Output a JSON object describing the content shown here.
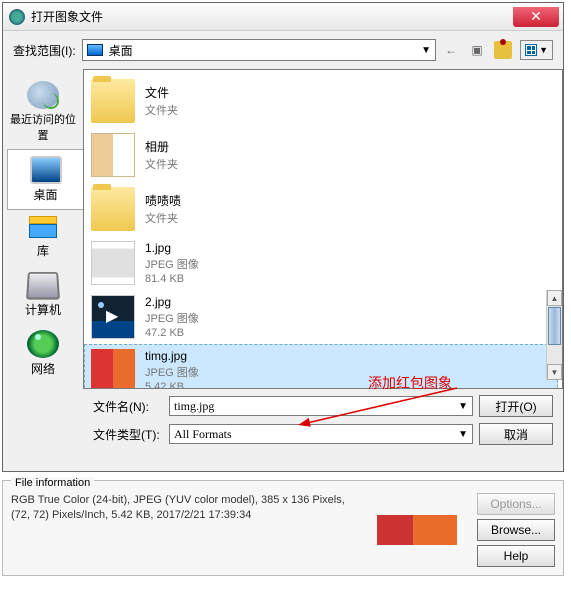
{
  "window": {
    "title": "打开图象文件"
  },
  "toolbar": {
    "lookin_label": "查找范围(I):",
    "location": "桌面"
  },
  "sidebar": {
    "items": [
      {
        "label": "最近访问的位置"
      },
      {
        "label": "桌面"
      },
      {
        "label": "库"
      },
      {
        "label": "计算机"
      },
      {
        "label": "网络"
      }
    ]
  },
  "files": [
    {
      "name": "文件",
      "type": "文件夹",
      "size": ""
    },
    {
      "name": "相册",
      "type": "文件夹",
      "size": ""
    },
    {
      "name": "啧啧啧",
      "type": "文件夹",
      "size": ""
    },
    {
      "name": "1.jpg",
      "type": "JPEG 图像",
      "size": "81.4 KB"
    },
    {
      "name": "2.jpg",
      "type": "JPEG 图像",
      "size": "47.2 KB"
    },
    {
      "name": "timg.jpg",
      "type": "JPEG 图像",
      "size": "5.42 KB"
    }
  ],
  "fields": {
    "filename_label": "文件名(N):",
    "filename_value": "timg.jpg",
    "filetype_label": "文件类型(T):",
    "filetype_value": "All Formats"
  },
  "buttons": {
    "open": "打开(O)",
    "cancel": "取消"
  },
  "annotation": "添加红包图象",
  "info": {
    "legend": "File information",
    "text": "RGB True Color (24-bit),  JPEG (YUV color model),  385 x 136 Pixels,  (72, 72) Pixels/Inch,  5.42 KB,  2017/2/21 17:39:34",
    "options": "Options...",
    "browse": "Browse...",
    "help": "Help"
  }
}
